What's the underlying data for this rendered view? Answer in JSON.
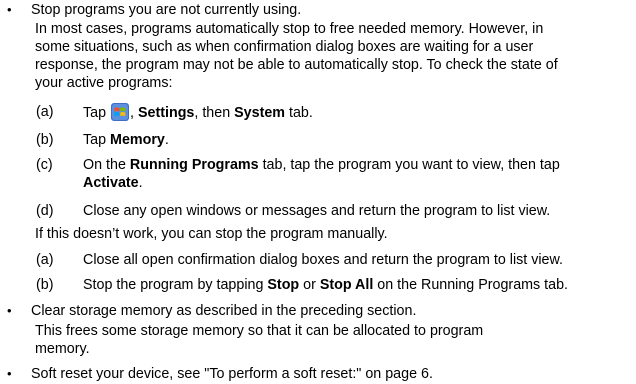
{
  "bullets": [
    {
      "title": "Stop programs you are not currently using.",
      "paragraph": [
        "In most cases, programs automatically stop to free needed memory. However, in",
        "some situations, such as when confirmation dialog boxes are waiting for a user",
        "response, the program may not be able to automatically stop. To check the state of",
        "your active programs:"
      ],
      "steps": [
        {
          "label": "(a)",
          "parts": [
            "Tap ",
            "",
            ", ",
            "Settings",
            ", then ",
            "System",
            " tab."
          ]
        },
        {
          "label": "(b)",
          "parts": [
            "Tap ",
            "Memory",
            "."
          ]
        },
        {
          "label": "(c)",
          "line1": [
            "On the ",
            "Running Programs",
            " tab, tap the program you want to view, then tap"
          ],
          "line2": [
            "Activate",
            "."
          ]
        },
        {
          "label": "(d)",
          "text": "Close any open windows or messages and return the program to list view."
        }
      ],
      "fallback": "If this doesn’t work, you can stop the program manually.",
      "manual_steps": [
        {
          "label": "(a)",
          "text": "Close all open confirmation dialog boxes and return the program to list view."
        },
        {
          "label": "(b)",
          "parts": [
            "Stop the program by tapping ",
            "Stop",
            " or ",
            "Stop All",
            " on the Running Programs tab."
          ]
        }
      ]
    },
    {
      "title": "Clear storage memory as described in the preceding section.",
      "paragraph": [
        "This frees some storage memory so that it can be allocated to program",
        "memory."
      ]
    },
    {
      "title": "Soft reset your device, see \"To perform a soft reset:\" on page 6."
    }
  ],
  "bullet_char": "•",
  "icons": {
    "start": "windows-start-icon"
  }
}
